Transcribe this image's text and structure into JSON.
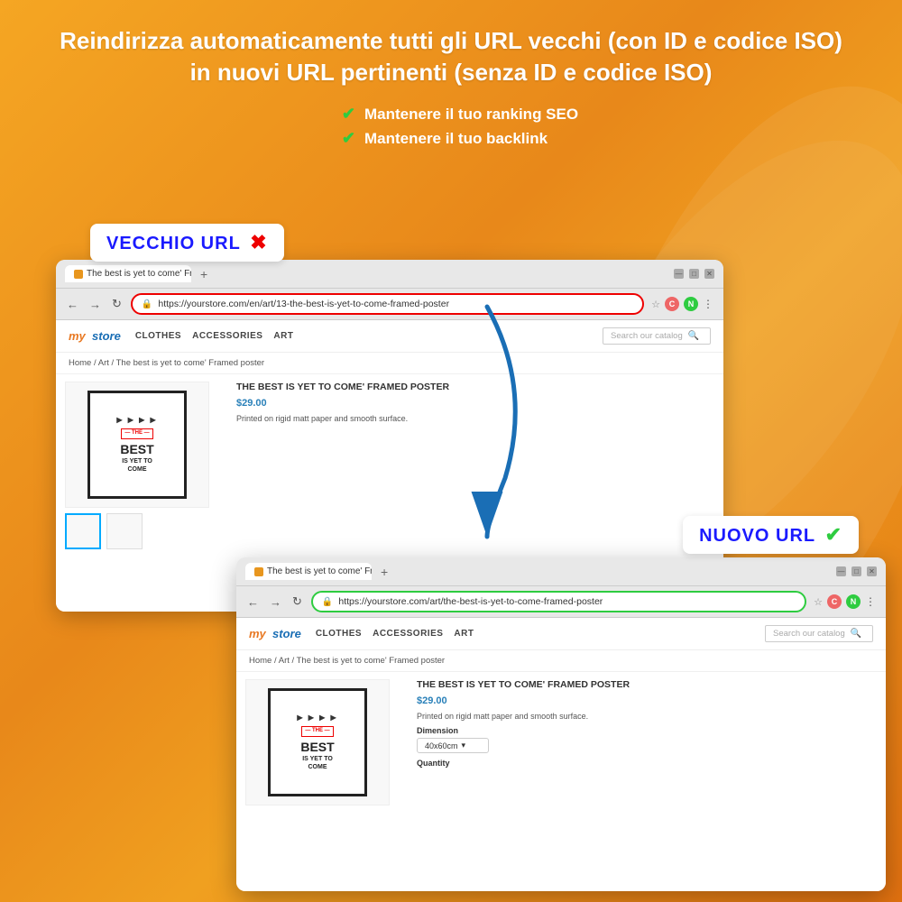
{
  "background": {
    "color": "#f0a020"
  },
  "header": {
    "title": "Reindirizza automaticamente tutti gli URL vecchi (con ID e codice ISO)  in nuovi URL pertinenti (senza ID e codice ISO)",
    "bullets": [
      "Mantenere il tuo ranking SEO",
      "Mantenere il tuo backlink"
    ]
  },
  "vecchio_label": {
    "text": "VECCHIO URL",
    "icon": "✖"
  },
  "nuovo_label": {
    "text": "NUOVO URL",
    "icon": "✔"
  },
  "browser_old": {
    "tab_title": "The best is yet to come' Framed",
    "url": "https://yourstore.com/en/art/13-the-best-is-yet-to-come-framed-poster",
    "store": {
      "logo_my": "my",
      "logo_store": "store",
      "nav": [
        "CLOTHES",
        "ACCESSORIES",
        "ART"
      ],
      "search_placeholder": "Search our catalog"
    },
    "breadcrumb": "Home / Art / The best is yet to come' Framed poster",
    "product": {
      "title": "THE BEST IS YET TO COME' FRAMED POSTER",
      "price": "$29.00",
      "description": "Printed on rigid matt paper and smooth surface."
    }
  },
  "browser_new": {
    "tab_title": "The best is yet to come' Framed",
    "url": "https://yourstore.com/art/the-best-is-yet-to-come-framed-poster",
    "store": {
      "logo_my": "my",
      "logo_store": "store",
      "nav": [
        "CLOTHES",
        "ACCESSORIES",
        "ART"
      ],
      "search_placeholder": "Search our catalog"
    },
    "breadcrumb": "Home / Art / The best is yet to come' Framed poster",
    "product": {
      "title": "THE BEST IS YET TO COME' FRAMED POSTER",
      "price": "$29.00",
      "description": "Printed on rigid matt paper and smooth surface.",
      "dimension_label": "Dimension",
      "dimension_value": "40x60cm",
      "quantity_label": "Quantity"
    }
  },
  "icons": {
    "checkmark": "✔",
    "x_mark": "✖",
    "search": "🔍",
    "lock": "🔒",
    "star": "☆",
    "back": "←",
    "forward": "→",
    "refresh": "↻",
    "dots": "⋮",
    "close": "✕",
    "plus": "+"
  }
}
